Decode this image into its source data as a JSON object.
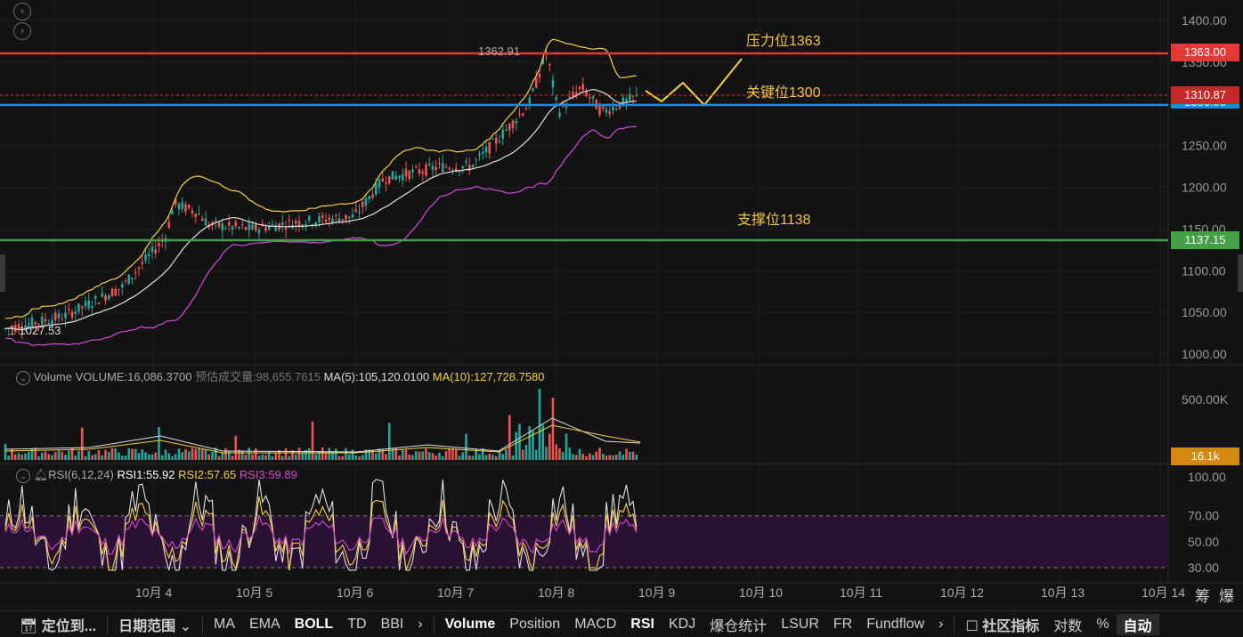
{
  "main_pane": {
    "price_axis_ticks": [
      "1400.00",
      "1350.00",
      "1250.00",
      "1200.00",
      "1150.00",
      "1100.00",
      "1050.00",
      "1000.00"
    ],
    "high_marker": "1362.91",
    "low_marker": "1027.53",
    "annotations": {
      "resistance": "压力位1363",
      "key": "关键位1300",
      "support": "支撑位1138"
    },
    "price_tags": {
      "resistance": "1363.00",
      "current": "1310.87",
      "key": "1300.00",
      "support": "1137.15"
    },
    "colors": {
      "resistance": "#e53935",
      "key": "#1e88e5",
      "support": "#43a047",
      "current": "#e53935",
      "annotation": "#f5c542",
      "up": "#26a69a",
      "down": "#ef5350"
    }
  },
  "volume_pane": {
    "title": "Volume",
    "volume": "VOLUME:16,086.3700",
    "estimated": "预估成交量:98,655.7615",
    "ma5": "MA(5):105,120.0100",
    "ma10": "MA(10):127,728.7580",
    "axis_tick": "500.00K",
    "tag": "16.1k"
  },
  "rsi_pane": {
    "title": "RSI(6,12,24)",
    "rsi1": "RSI1:55.92",
    "rsi2": "RSI2:57.65",
    "rsi3": "RSI3:59.89",
    "ticks": [
      "100.00",
      "70.00",
      "50.00",
      "30.00"
    ]
  },
  "x_axis": [
    "10月 4",
    "10月 5",
    "10月 6",
    "10月 7",
    "10月 8",
    "10月 9",
    "10月 10",
    "10月 11",
    "10月 12",
    "10月 13",
    "10月 14"
  ],
  "corner_icons": {
    "a": "筹",
    "b": "爆"
  },
  "toolbar": {
    "locate": "定位到...",
    "date_range": "日期范围",
    "main_indicators": [
      "MA",
      "EMA",
      "BOLL",
      "TD",
      "BBI"
    ],
    "sub_indicators": [
      "Volume",
      "Position",
      "MACD",
      "RSI",
      "KDJ",
      "爆仓统计",
      "LSUR",
      "FR",
      "Fundflow"
    ],
    "community": "社区指标",
    "log": "对数",
    "percent": "%",
    "auto": "自动"
  }
}
